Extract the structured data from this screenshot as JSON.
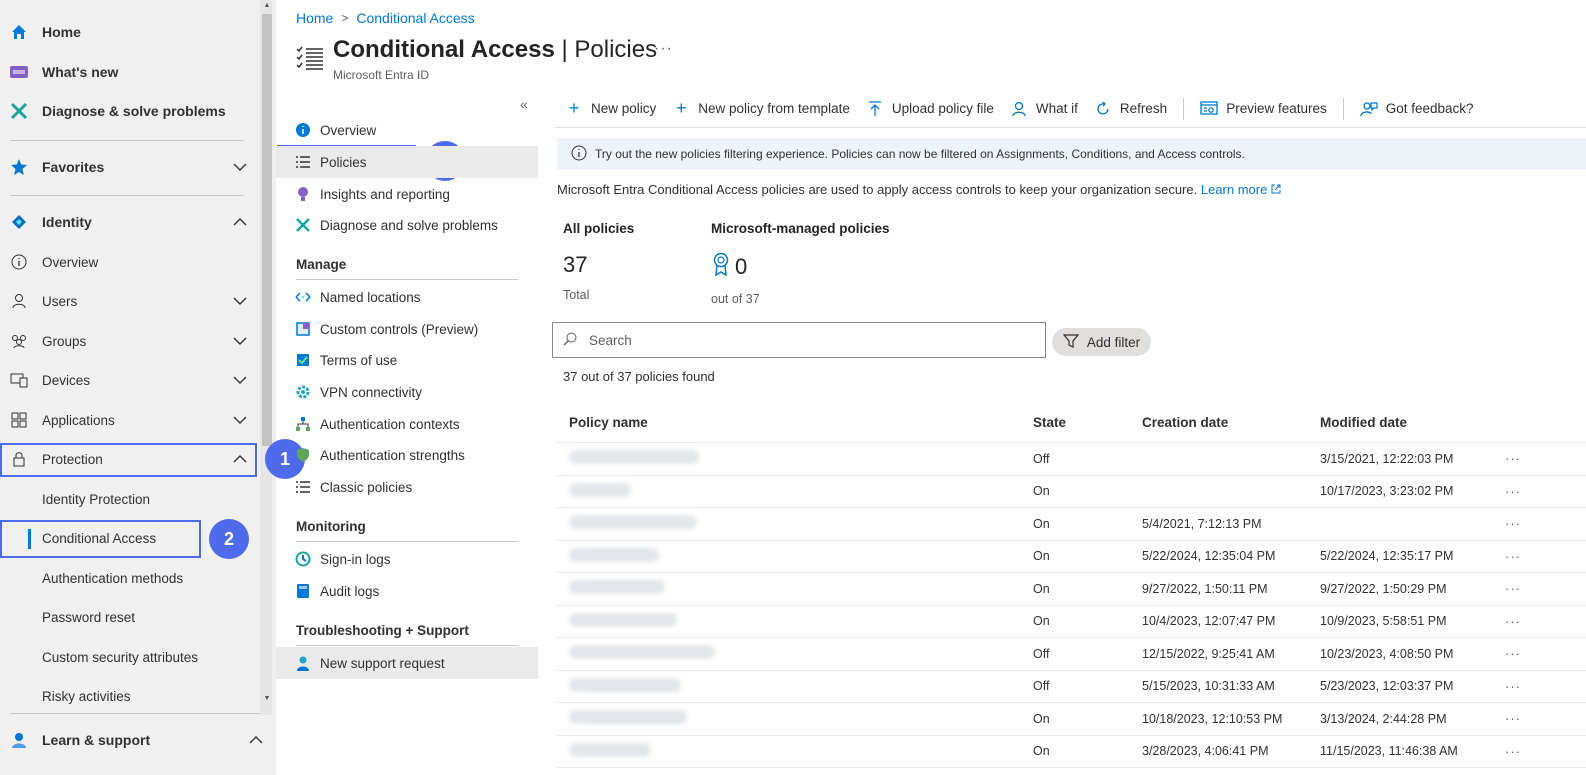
{
  "leftnav": {
    "home": "Home",
    "whats_new": "What's new",
    "diagnose": "Diagnose & solve problems",
    "favorites": "Favorites",
    "identity": "Identity",
    "overview": "Overview",
    "users": "Users",
    "groups": "Groups",
    "devices": "Devices",
    "applications": "Applications",
    "protection": "Protection",
    "identity_protection": "Identity Protection",
    "conditional_access": "Conditional Access",
    "authentication_methods": "Authentication methods",
    "password_reset": "Password reset",
    "custom_security_attributes": "Custom security attributes",
    "risky_activities": "Risky activities",
    "learn_support": "Learn & support"
  },
  "badges": {
    "b1": "1",
    "b2": "2",
    "b3": "3"
  },
  "header": {
    "breadcrumb_home": "Home",
    "breadcrumb_sep": ">",
    "breadcrumb_current": "Conditional Access",
    "title_main": "Conditional Access",
    "title_sep": " | ",
    "title_sub": "Policies",
    "subtitle": "Microsoft Entra ID",
    "more": "···"
  },
  "menu": {
    "collapse": "«",
    "overview": "Overview",
    "policies": "Policies",
    "insights": "Insights and reporting",
    "diagnose": "Diagnose and solve problems",
    "manage": "Manage",
    "named_locations": "Named locations",
    "custom_controls": "Custom controls (Preview)",
    "terms_of_use": "Terms of use",
    "vpn": "VPN connectivity",
    "auth_contexts": "Authentication contexts",
    "auth_strengths": "Authentication strengths",
    "classic_policies": "Classic policies",
    "monitoring": "Monitoring",
    "signin_logs": "Sign-in logs",
    "audit_logs": "Audit logs",
    "troubleshooting": "Troubleshooting + Support",
    "new_support": "New support request"
  },
  "toolbar": {
    "new_policy": "New policy",
    "new_from_template": "New policy from template",
    "upload": "Upload policy file",
    "what_if": "What if",
    "refresh": "Refresh",
    "preview": "Preview features",
    "feedback": "Got feedback?"
  },
  "info": "Try out the new policies filtering experience. Policies can now be filtered on Assignments, Conditions, and Access controls.",
  "intro": {
    "text": "Microsoft Entra Conditional Access policies are used to apply access controls to keep your organization secure.",
    "link": "Learn more"
  },
  "stats": {
    "all_label": "All policies",
    "all_value": "37",
    "all_sub": "Total",
    "managed_label": "Microsoft-managed policies",
    "managed_value": "0",
    "managed_sub": "out of 37"
  },
  "search": {
    "placeholder": "Search"
  },
  "filter": {
    "label": "Add filter"
  },
  "found": "37 out of 37 policies found",
  "table": {
    "headers": [
      "Policy name",
      "State",
      "Creation date",
      "Modified date"
    ],
    "rows": [
      {
        "state": "Off",
        "created": "",
        "modified": "3/15/2021, 12:22:03 PM",
        "more": "···"
      },
      {
        "state": "On",
        "created": "",
        "modified": "10/17/2023, 3:23:02 PM",
        "more": "···"
      },
      {
        "state": "On",
        "created": "5/4/2021, 7:12:13 PM",
        "modified": "",
        "more": "···"
      },
      {
        "state": "On",
        "created": "5/22/2024, 12:35:04 PM",
        "modified": "5/22/2024, 12:35:17 PM",
        "more": "···"
      },
      {
        "state": "On",
        "created": "9/27/2022, 1:50:11 PM",
        "modified": "9/27/2022, 1:50:29 PM",
        "more": "···"
      },
      {
        "state": "On",
        "created": "10/4/2023, 12:07:47 PM",
        "modified": "10/9/2023, 5:58:51 PM",
        "more": "···"
      },
      {
        "state": "Off",
        "created": "12/15/2022, 9:25:41 AM",
        "modified": "10/23/2023, 4:08:50 PM",
        "more": "···"
      },
      {
        "state": "Off",
        "created": "5/15/2023, 10:31:33 AM",
        "modified": "5/23/2023, 12:03:37 PM",
        "more": "···"
      },
      {
        "state": "On",
        "created": "10/18/2023, 12:10:53 PM",
        "modified": "3/13/2024, 2:44:28 PM",
        "more": "···"
      },
      {
        "state": "On",
        "created": "3/28/2023, 4:06:41 PM",
        "modified": "11/15/2023, 11:46:38 AM",
        "more": "···"
      }
    ]
  }
}
